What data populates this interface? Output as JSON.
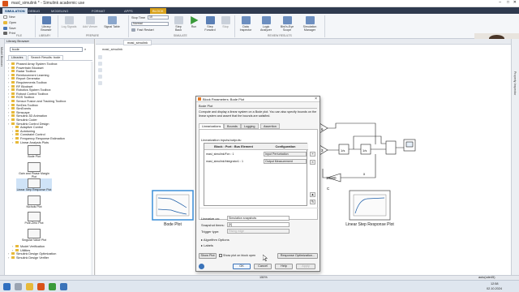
{
  "window": {
    "title": "masl_simulink * - Simulink academic use"
  },
  "ribbon_tabs": [
    "SIMULATION",
    "DEBUG",
    "MODELING",
    "FORMAT",
    "APPS",
    "BLOCK"
  ],
  "ribbon": {
    "new": "New",
    "open": "Open",
    "save": "Save",
    "print": "Print",
    "library_browser": "Library Browser",
    "log_signals": "Log Signals",
    "add_viewer": "Add Viewer",
    "signal_table": "Signal Table",
    "stop_time_label": "Stop Time",
    "stop_time_value": "10",
    "mode_value": "Normal",
    "fast_restart": "Fast Restart",
    "step_back": "Step Back",
    "run": "Run",
    "step_forward": "Step Forward",
    "stop": "Stop",
    "data_inspector": "Data Inspector",
    "logic_analyzer": "Logic Analyzer",
    "birds_eye_scope": "Bird's-Eye Scope",
    "simulation_manager": "Simulation Manager",
    "groups": [
      "FILE",
      "LIBRARY",
      "PREPARE",
      "SIMULATE",
      "REVIEW RESULTS"
    ]
  },
  "webcam": {
    "name": "Александр Петровский"
  },
  "strips": {
    "model_browser": "Model Browser",
    "property_inspector": "Property Inspector"
  },
  "library_browser": {
    "title": "Library Browser",
    "search": "bode",
    "tabs": [
      "Libraries",
      "Search Results: bode"
    ],
    "tree": [
      {
        "label": "Phased Array System Toolbox",
        "level": 0
      },
      {
        "label": "Powertrain Blockset",
        "level": 0
      },
      {
        "label": "Radar Toolbox",
        "level": 0
      },
      {
        "label": "Reinforcement Learning",
        "level": 0
      },
      {
        "label": "Report Generator",
        "level": 0
      },
      {
        "label": "Requirements Toolbox",
        "level": 0
      },
      {
        "label": "RF Blockset",
        "level": 0
      },
      {
        "label": "Robotics System Toolbox",
        "level": 0
      },
      {
        "label": "Robust Control Toolbox",
        "level": 0
      },
      {
        "label": "ROS Toolbox",
        "level": 0
      },
      {
        "label": "Sensor Fusion and Tracking Toolbox",
        "level": 0
      },
      {
        "label": "SerDes Toolbox",
        "level": 0
      },
      {
        "label": "SimEvents",
        "level": 0
      },
      {
        "label": "Simscape",
        "level": 0
      },
      {
        "label": "Simulink 3D Animation",
        "level": 0
      },
      {
        "label": "Simulink Coder",
        "level": 0
      },
      {
        "label": "Simulink Control Design",
        "level": 0
      },
      {
        "label": "Adaptive Control",
        "level": 1
      },
      {
        "label": "Autotuning",
        "level": 1
      },
      {
        "label": "Constraint Control",
        "level": 1
      },
      {
        "label": "Frequency Response Estimation",
        "level": 1
      },
      {
        "label": "Linear Analysis Plots",
        "level": 1
      }
    ],
    "blocks": [
      "Bode Plot",
      "Gain and Phase Margin Plot",
      "Linear Step Response Plot",
      "Nichols Plot",
      "Pole-Zero Plot",
      "Singular Value Plot"
    ],
    "tree_bottom": [
      {
        "label": "Model Verification",
        "level": 1
      },
      {
        "label": "Utilities",
        "level": 1
      },
      {
        "label": "Simulink Design Optimization",
        "level": 0
      },
      {
        "label": "Simulink Design Verifier",
        "level": 0
      }
    ]
  },
  "model": {
    "tab": "masl_simulink",
    "breadcrumb": "masl_simulink",
    "bode_label": "Bode Plot",
    "step_label": "Linear Step Response Plot",
    "gain_top": "6",
    "gain_left": "3",
    "gain_bottom": "10000",
    "int1": "1/s",
    "int2": "1/s",
    "sig_x": "x",
    "sig_c": "C"
  },
  "dialog": {
    "title": "Block Parameters: Bode Plot",
    "heading": "Bode Plot",
    "description": "Compute and display a linear system on a Bode plot. You can also specify bounds on the linear system and assert that the bounds are satisfied.",
    "tabs": [
      "Linearizations",
      "Bounds",
      "Logging",
      "Assertion"
    ],
    "io_label": "Linearization inputs/outputs:",
    "col_block": "Block : Port : Bus Element",
    "col_config": "Configuration",
    "rows": [
      {
        "block": "masl_simulink/Fcn : 1",
        "config": "Input Perturbation"
      },
      {
        "block": "masl_simulink/Integrator1 : 1",
        "config": "Output Measurement"
      }
    ],
    "linearize_label": "Linearize on:",
    "linearize_value": "Simulation snapshots",
    "snapshot_label": "Snapshot times:",
    "snapshot_value": "[0]",
    "trigger_label": "Trigger type:",
    "trigger_value": "Rising edge",
    "algorithm_options": "Algorithm Options",
    "labels": "Labels",
    "show_plot": "Show Plot",
    "show_on_open": "Show plot on block open",
    "response_opt": "Response Optimization...",
    "ok": "OK",
    "cancel": "Cancel",
    "help": "Help",
    "apply": "Apply"
  },
  "status": {
    "zoom": "150%",
    "solver": "auto(ode45)"
  },
  "taskbar": {
    "time": "12:58",
    "date": "02.10.2024"
  }
}
